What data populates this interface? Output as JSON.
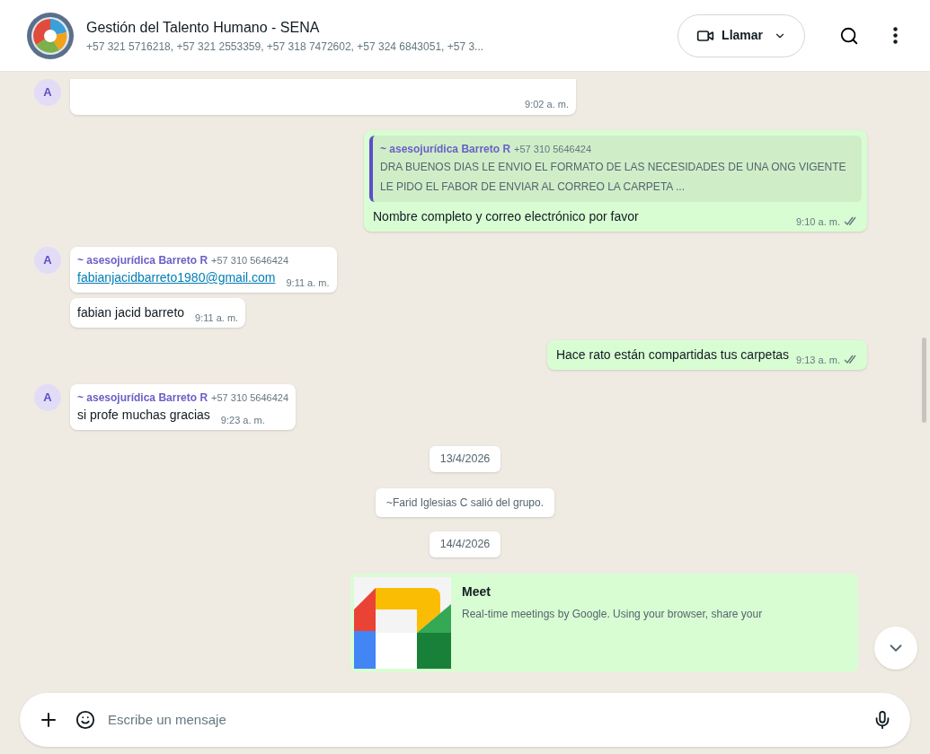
{
  "header": {
    "title": "Gestión del Talento Humano - SENA",
    "subtitle": "+57 321 5716218, +57 321 2553359, +57 318 7472602, +57 324 6843051, +57 3...",
    "call_label": "Llamar"
  },
  "messages": [
    {
      "kind": "incoming_tail",
      "avatar": "A",
      "time": "9:02 a. m."
    },
    {
      "kind": "outgoing",
      "quote": {
        "sender": "~ asesojurídica Barreto R",
        "phone": "+57 310 5646424",
        "text": "DRA BUENOS DIAS LE ENVIO EL FORMATO DE LAS NECESIDADES DE UNA ONG VIGENTE  LE PIDO EL FABOR DE ENVIAR AL CORREO LA CARPETA ..."
      },
      "text": "Nombre completo y correo electrónico por favor",
      "time": "9:10 a. m.",
      "read": false
    },
    {
      "kind": "incoming",
      "avatar": "A",
      "sender": "~ asesojurídica Barreto R",
      "phone": "+57 310 5646424",
      "text": "fabianjacidbarreto1980@gmail.com",
      "is_link": true,
      "time": "9:11 a. m."
    },
    {
      "kind": "incoming",
      "text": "fabian jacid barreto",
      "is_link": false,
      "time": "9:11 a. m."
    },
    {
      "kind": "outgoing",
      "text": "Hace rato están compartidas tus carpetas",
      "time": "9:13 a. m.",
      "read": false
    },
    {
      "kind": "incoming",
      "avatar": "A",
      "sender": "~ asesojurídica Barreto R",
      "phone": "+57 310 5646424",
      "text": "si profe  muchas gracias",
      "is_link": false,
      "time": "9:23 a. m."
    },
    {
      "kind": "date",
      "text": "13/4/2026"
    },
    {
      "kind": "system",
      "text": "~Farid Iglesias C salió del grupo."
    },
    {
      "kind": "date",
      "text": "14/4/2026"
    },
    {
      "kind": "link_preview",
      "title": "Meet",
      "text": "Real-time meetings by Google. Using your browser, share your"
    }
  ],
  "composer": {
    "placeholder": "Escribe un mensaje"
  }
}
